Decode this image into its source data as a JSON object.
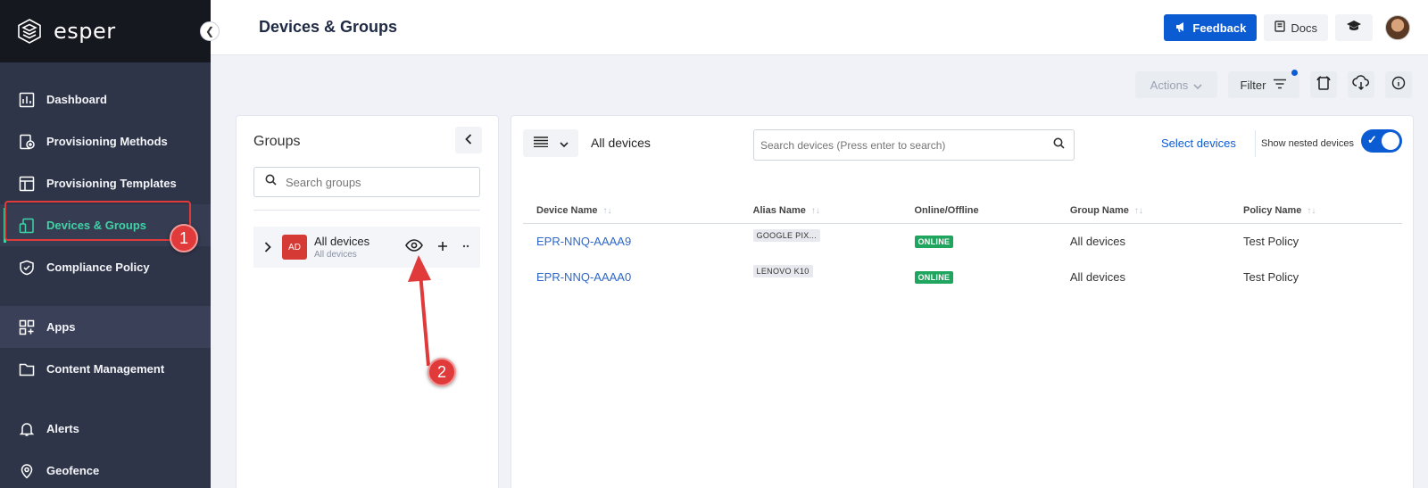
{
  "brand": {
    "name": "esper"
  },
  "sidebar": {
    "items": [
      {
        "label": "Dashboard",
        "icon": "dashboard-icon"
      },
      {
        "label": "Provisioning Methods",
        "icon": "provisioning-methods-icon"
      },
      {
        "label": "Provisioning Templates",
        "icon": "template-icon"
      },
      {
        "label": "Devices & Groups",
        "icon": "devices-icon",
        "active": true
      },
      {
        "label": "Compliance Policy",
        "icon": "shield-icon"
      },
      {
        "label": "Apps",
        "icon": "apps-icon"
      },
      {
        "label": "Content Management",
        "icon": "folder-icon"
      },
      {
        "label": "Alerts",
        "icon": "bell-icon"
      },
      {
        "label": "Geofence",
        "icon": "map-pin-icon"
      }
    ]
  },
  "header": {
    "title": "Devices & Groups",
    "feedback_label": "Feedback",
    "docs_label": "Docs"
  },
  "toolbar": {
    "actions_label": "Actions",
    "filter_label": "Filter"
  },
  "groups": {
    "title": "Groups",
    "search_placeholder": "Search groups",
    "items": [
      {
        "badge": "AD",
        "name": "All devices",
        "subtitle": "All devices"
      }
    ]
  },
  "devices": {
    "view_label": "All devices",
    "search_placeholder": "Search devices (Press enter to search)",
    "select_label": "Select devices",
    "nested_label": "Show nested devices",
    "nested_enabled": true,
    "columns": [
      "Device Name",
      "Alias Name",
      "Online/Offline",
      "Group Name",
      "Policy Name"
    ],
    "rows": [
      {
        "device": "EPR-NNQ-AAAA9",
        "alias": "GOOGLE PIX...",
        "status": "ONLINE",
        "group": "All devices",
        "policy": "Test Policy"
      },
      {
        "device": "EPR-NNQ-AAAA0",
        "alias": "LENOVO K10",
        "status": "ONLINE",
        "group": "All devices",
        "policy": "Test Policy"
      }
    ]
  },
  "annotations": {
    "step1": "1",
    "step2": "2"
  },
  "colors": {
    "accent": "#0b5bd3",
    "active_nav": "#3fd3a6",
    "online": "#20a55e",
    "callout": "#e03a3a"
  }
}
